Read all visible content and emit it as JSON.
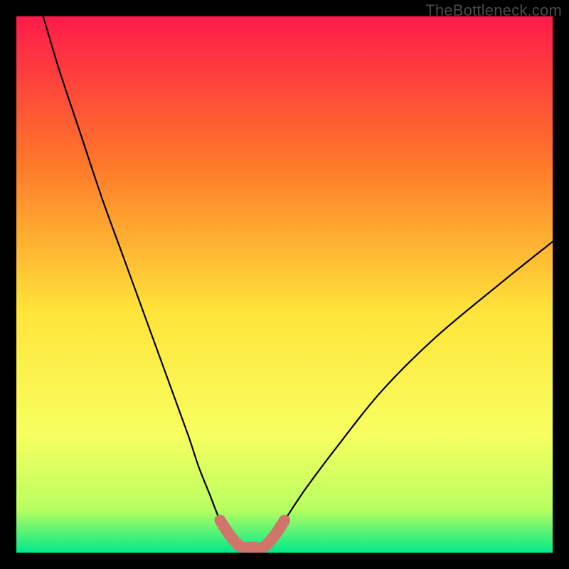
{
  "watermark": "TheBottleneck.com",
  "colors": {
    "frame_bg": "#000000",
    "gradient_top": "#ff1a4a",
    "gradient_mid_upper": "#ff7a2a",
    "gradient_mid": "#ffe43a",
    "gradient_lower": "#f8ff60",
    "gradient_green_upper": "#b8ff60",
    "gradient_bottom": "#00e88a",
    "curve": "#000000",
    "highlight": "#d1746c"
  },
  "chart_data": {
    "type": "line",
    "title": "",
    "xlabel": "",
    "ylabel": "",
    "xlim": [
      0,
      100
    ],
    "ylim": [
      0,
      100
    ],
    "series": [
      {
        "name": "bottleneck-curve",
        "x": [
          5,
          8,
          12,
          16,
          20,
          24,
          28,
          32,
          34,
          36,
          38,
          40,
          42,
          44,
          46,
          48,
          50,
          54,
          60,
          68,
          78,
          90,
          100
        ],
        "y": [
          100,
          90,
          78,
          66,
          55,
          44,
          33,
          22,
          16,
          11,
          6,
          3,
          1,
          1,
          1,
          3,
          6,
          12,
          20,
          30,
          40,
          50,
          58
        ]
      },
      {
        "name": "optimal-highlight",
        "x": [
          38,
          40,
          42,
          44,
          46,
          48,
          50
        ],
        "y": [
          6,
          3,
          1,
          1,
          1,
          3,
          6
        ]
      }
    ],
    "annotations": []
  }
}
